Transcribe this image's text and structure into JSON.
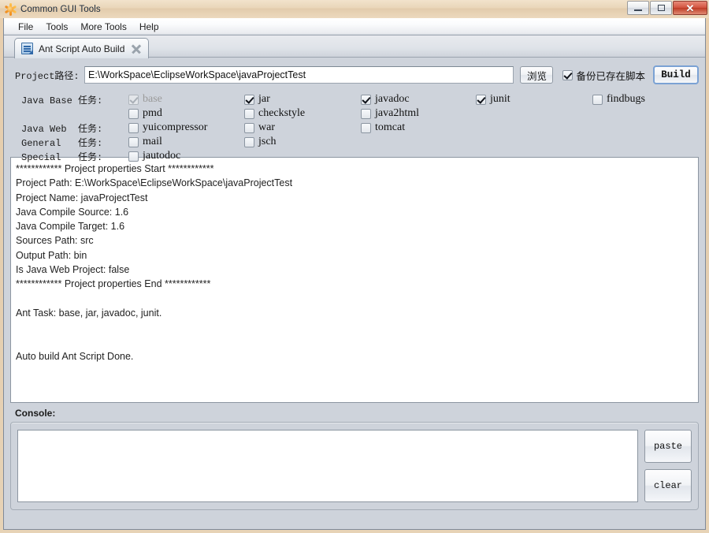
{
  "window": {
    "title": "Common GUI Tools",
    "app_icon": "sparkle-icon",
    "controls": {
      "minimize": "minimize-icon",
      "maximize": "maximize-icon",
      "close": "✕"
    }
  },
  "menubar": {
    "items": [
      {
        "label": "File"
      },
      {
        "label": "Tools"
      },
      {
        "label": "More Tools"
      },
      {
        "label": "Help"
      }
    ]
  },
  "tabs": [
    {
      "label": "Ant Script Auto Build",
      "icon": "script-document-icon",
      "close": "close-icon",
      "active": true
    }
  ],
  "form": {
    "path_label": "Project路径:",
    "path_value": "E:\\WorkSpace\\EclipseWorkSpace\\javaProjectTest",
    "path_placeholder": "",
    "browse_label": "浏览",
    "backup_label": "备份已存在脚本",
    "backup_checked": true,
    "build_label": "Build"
  },
  "task_rows": [
    {
      "label": "Java Base 任务:"
    },
    {
      "label": "Java Web  任务:"
    },
    {
      "label": "General   任务:"
    },
    {
      "label": "Special   任务:"
    }
  ],
  "tasks": [
    {
      "name": "base",
      "checked": true,
      "disabled": true,
      "col": 0,
      "row": 0
    },
    {
      "name": "jar",
      "checked": true,
      "disabled": false,
      "col": 1,
      "row": 0
    },
    {
      "name": "javadoc",
      "checked": true,
      "disabled": false,
      "col": 2,
      "row": 0
    },
    {
      "name": "junit",
      "checked": true,
      "disabled": false,
      "col": 3,
      "row": 0
    },
    {
      "name": "findbugs",
      "checked": false,
      "disabled": false,
      "col": 4,
      "row": 0
    },
    {
      "name": "pmd",
      "checked": false,
      "disabled": false,
      "col": 0,
      "row": 1
    },
    {
      "name": "checkstyle",
      "checked": false,
      "disabled": false,
      "col": 1,
      "row": 1
    },
    {
      "name": "java2html",
      "checked": false,
      "disabled": false,
      "col": 2,
      "row": 1
    },
    {
      "name": "yuicompressor",
      "checked": false,
      "disabled": false,
      "col": 0,
      "row": 2
    },
    {
      "name": "war",
      "checked": false,
      "disabled": false,
      "col": 1,
      "row": 2
    },
    {
      "name": "tomcat",
      "checked": false,
      "disabled": false,
      "col": 2,
      "row": 2
    },
    {
      "name": "mail",
      "checked": false,
      "disabled": false,
      "col": 0,
      "row": 3
    },
    {
      "name": "jsch",
      "checked": false,
      "disabled": false,
      "col": 1,
      "row": 3
    },
    {
      "name": "jautodoc",
      "checked": false,
      "disabled": false,
      "col": 0,
      "row": 4
    }
  ],
  "output": {
    "lines": [
      "************ Project properties Start ************",
      "Project Path: E:\\WorkSpace\\EclipseWorkSpace\\javaProjectTest",
      "Project Name: javaProjectTest",
      "Java Compile Source: 1.6",
      "Java Compile Target: 1.6",
      "Sources Path: src",
      "Output Path: bin",
      "Is Java Web Project: false",
      "************ Project properties End ************",
      "",
      "Ant Task: base, jar, javadoc, junit.",
      "",
      "",
      "Auto build Ant Script Done."
    ]
  },
  "console": {
    "label": "Console:",
    "input_value": "",
    "input_placeholder": "",
    "paste_label": "paste",
    "clear_label": "clear"
  },
  "colors": {
    "panel_bg": "#ced3db",
    "frame": "#e4cdae",
    "field_bg": "#ffffff",
    "accent_focus": "#7ba2d4",
    "close_red": "#bd3a23"
  }
}
